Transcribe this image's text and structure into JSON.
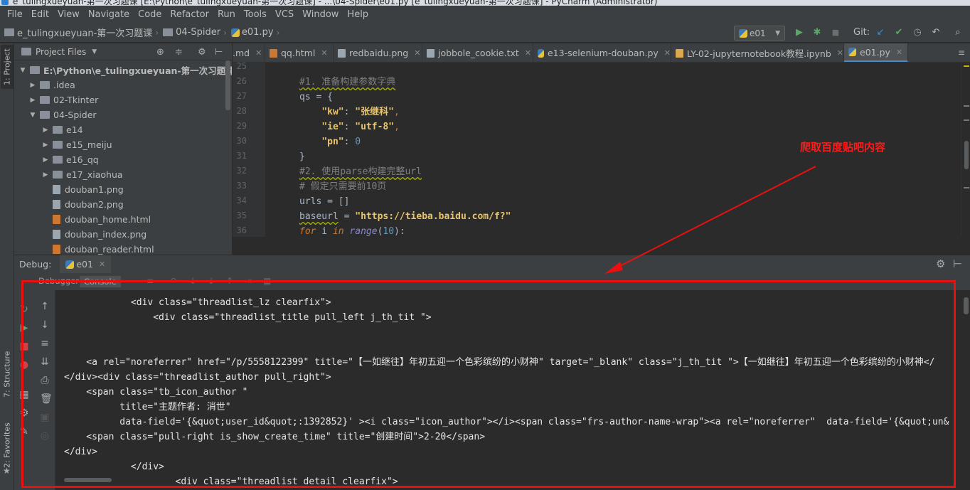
{
  "window": {
    "title": "e_tulingxueyuan-第一次习题课 [E:\\Python\\e_tulingxueyuan-第一次习题课] - ...\\04-Spider\\e01.py [e_tulingxueyuan-第一次习题课] - PyCharm (Administrator)"
  },
  "menu": [
    "File",
    "Edit",
    "View",
    "Navigate",
    "Code",
    "Refactor",
    "Run",
    "Tools",
    "VCS",
    "Window",
    "Help"
  ],
  "breadcrumb": {
    "project": "e_tulingxueyuan-第一次习题课",
    "folder": "04-Spider",
    "file": "e01.py"
  },
  "run_config": "e01",
  "git_label": "Git:",
  "project_panel": {
    "title": "Project Files",
    "root": "E:\\Python\\e_tulingxueyuan-第一次习题课",
    "items": [
      {
        "label": ".idea",
        "kind": "folder",
        "expanded": false
      },
      {
        "label": "02-Tkinter",
        "kind": "folder",
        "expanded": false
      },
      {
        "label": "04-Spider",
        "kind": "folder",
        "expanded": true
      },
      {
        "label": "e14",
        "kind": "folder",
        "expanded": false
      },
      {
        "label": "e15_meiju",
        "kind": "folder",
        "expanded": false
      },
      {
        "label": "e16_qq",
        "kind": "folder",
        "expanded": false
      },
      {
        "label": "e17_xiaohua",
        "kind": "folder",
        "expanded": false
      },
      {
        "label": "douban1.png",
        "kind": "image"
      },
      {
        "label": "douban2.png",
        "kind": "image"
      },
      {
        "label": "douban_home.html",
        "kind": "html"
      },
      {
        "label": "douban_index.png",
        "kind": "image"
      },
      {
        "label": "douban_reader.html",
        "kind": "html"
      }
    ]
  },
  "side_tabs": {
    "project": "1: Project",
    "structure": "7: Structure",
    "favorites": "2: Favorites"
  },
  "editor_tabs": [
    {
      "label": ".md",
      "icon": "file-icon"
    },
    {
      "label": "qq.html",
      "icon": "html-icon"
    },
    {
      "label": "redbaidu.png",
      "icon": "image-icon"
    },
    {
      "label": "jobbole_cookie.txt",
      "icon": "text-file-icon"
    },
    {
      "label": "e13-selenium-douban.py",
      "icon": "python-icon"
    },
    {
      "label": "LY-02-jupyternotebook教程.ipynb",
      "icon": "notebook-icon"
    },
    {
      "label": "e01.py",
      "icon": "python-icon",
      "active": true
    }
  ],
  "code": {
    "line_numbers": [
      "25",
      "26",
      "27",
      "28",
      "29",
      "30",
      "31",
      "32",
      "33",
      "34",
      "35",
      "36"
    ],
    "comment1": "#1. 准备构建参数字典",
    "qs_open_a": "qs",
    "qs_open_b": " = {",
    "kw_key": "\"kw\"",
    "kw_val": "\"张继科\"",
    "ie_key": "\"ie\"",
    "ie_val": "\"utf-8\"",
    "pn_key": "\"pn\"",
    "pn_val": "0",
    "close_brace": "}",
    "comment2": "#2. 使用parse构建完整url",
    "comment3": "# 假定只需要前10页",
    "urls_line": "urls = []",
    "baseurl_var": "baseurl",
    "baseurl_val": "\"https://tieba.baidu.com/f?\"",
    "for_kw": "for",
    "for_i": " i ",
    "in_kw": "in",
    "range_fn": "range",
    "range_open": "(",
    "range_num": "10",
    "range_close": "):"
  },
  "annotation": "爬取百度贴吧内容",
  "debug": {
    "label": "Debug:",
    "tab": "e01",
    "subtabs": {
      "debugger": "Debugger",
      "console": "Console"
    }
  },
  "console_lines": [
    "            <div class=\"threadlist_lz clearfix\">",
    "                <div class=\"threadlist_title pull_left j_th_tit \">",
    "",
    "",
    "    <a rel=\"noreferrer\" href=\"/p/5558122399\" title=\"【一如继往】年初五迎一个色彩缤纷的小财神\" target=\"_blank\" class=\"j_th_tit \">【一如继往】年初五迎一个色彩缤纷的小财神</",
    "</div><div class=\"threadlist_author pull_right\">",
    "    <span class=\"tb_icon_author \"",
    "          title=\"主题作者: 消世\"",
    "          data-field='{&quot;user_id&quot;:1392852}' ><i class=\"icon_author\"></i><span class=\"frs-author-name-wrap\"><a rel=\"noreferrer\"  data-field='{&quot;un&",
    "    <span class=\"pull-right is_show_create_time\" title=\"创建时间\">2-20</span>",
    "</div>",
    "            </div>",
    "                    <div class=\"threadlist_detail clearfix\">"
  ],
  "colors": {
    "accent": "#4a88c7",
    "annotation_red": "#e81010"
  }
}
